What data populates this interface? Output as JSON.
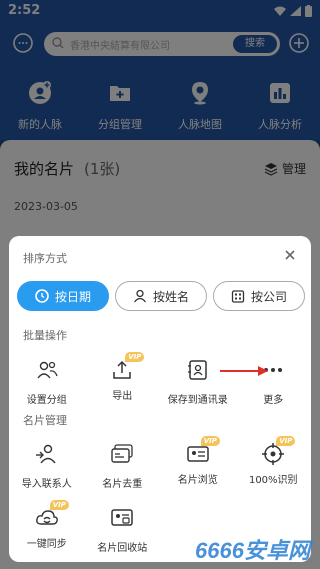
{
  "status_bar": {
    "time": "2:52"
  },
  "header": {
    "search_placeholder": "香港中央結算有限公司",
    "search_button": "搜索",
    "shortcuts": [
      {
        "label": "新的人脉",
        "icon": "user-add-icon"
      },
      {
        "label": "分组管理",
        "icon": "folder-add-icon"
      },
      {
        "label": "人脉地图",
        "icon": "map-pin-icon"
      },
      {
        "label": "人脉分析",
        "icon": "bar-chart-icon"
      }
    ]
  },
  "content": {
    "title": "我的名片",
    "count": "(1张)",
    "manage": "管理",
    "date": "2023-03-05"
  },
  "sheet": {
    "title": "排序方式",
    "sort_options": [
      {
        "label": "按日期",
        "icon": "clock-icon",
        "active": true
      },
      {
        "label": "按姓名",
        "icon": "person-icon",
        "active": false
      },
      {
        "label": "按公司",
        "icon": "building-icon",
        "active": false
      }
    ],
    "batch_section": "批量操作",
    "batch_items": [
      {
        "label": "设置分组",
        "icon": "group-users-icon",
        "vip": false
      },
      {
        "label": "导出",
        "icon": "upload-icon",
        "vip": true
      },
      {
        "label": "保存到通讯录",
        "icon": "contact-card-icon",
        "vip": false
      },
      {
        "label": "更多",
        "icon": "more-dots-icon",
        "vip": false
      }
    ],
    "card_section": "名片管理",
    "card_items_row1": [
      {
        "label": "导入联系人",
        "icon": "import-contact-icon",
        "vip": false
      },
      {
        "label": "名片去重",
        "icon": "dedupe-card-icon",
        "vip": false
      },
      {
        "label": "名片浏览",
        "icon": "browse-card-icon",
        "vip": true
      },
      {
        "label": "100%识别",
        "icon": "target-icon",
        "vip": true
      }
    ],
    "card_items_row2": [
      {
        "label": "一键同步",
        "icon": "cloud-sync-icon",
        "vip": true
      },
      {
        "label": "名片回收站",
        "icon": "recycle-card-icon",
        "vip": false
      }
    ],
    "vip_badge": "VIP",
    "accent_color": "#2a9cf0"
  },
  "watermark": {
    "number": "6666",
    "text": "安卓网"
  }
}
